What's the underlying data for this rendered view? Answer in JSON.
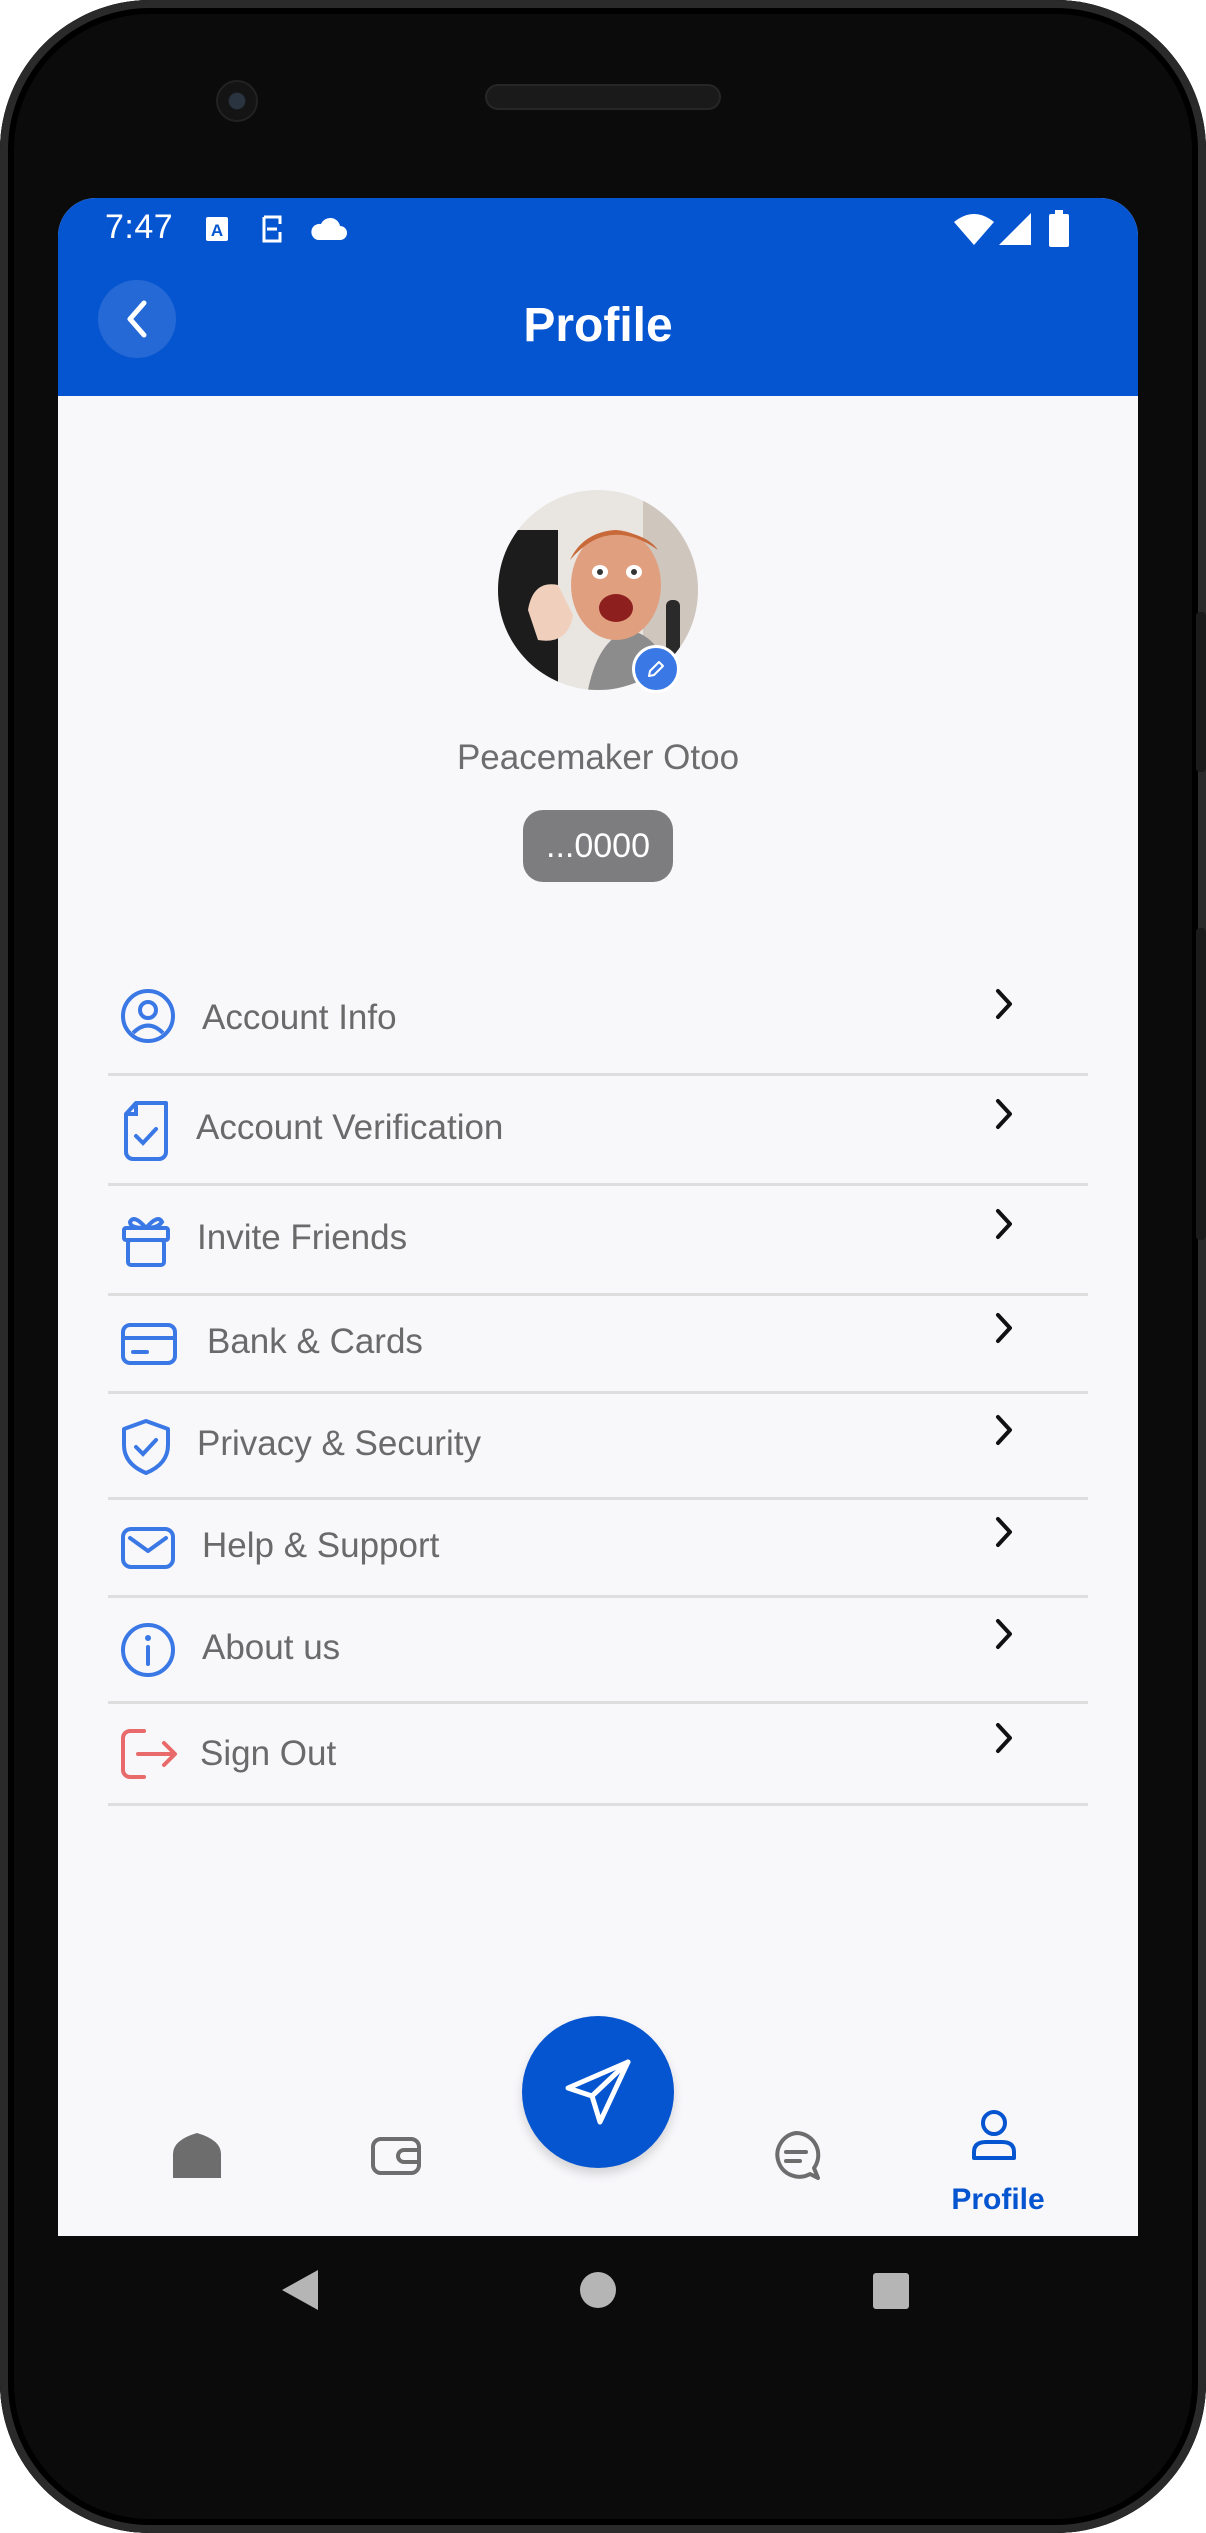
{
  "status_bar": {
    "time": "7:47"
  },
  "header": {
    "title": "Profile"
  },
  "profile": {
    "name": "Peacemaker Otoo",
    "account_suffix": "...0000"
  },
  "menu": {
    "items": [
      {
        "label": "Account Info",
        "icon": "user-circle-icon"
      },
      {
        "label": "Account Verification",
        "icon": "document-check-icon"
      },
      {
        "label": "Invite Friends",
        "icon": "gift-icon"
      },
      {
        "label": "Bank & Cards",
        "icon": "credit-card-icon"
      },
      {
        "label": "Privacy & Security",
        "icon": "shield-check-icon"
      },
      {
        "label": "Help & Support",
        "icon": "mail-icon"
      },
      {
        "label": "About us",
        "icon": "info-icon"
      },
      {
        "label": "Sign Out",
        "icon": "sign-out-icon"
      }
    ]
  },
  "bottom_nav": {
    "active_label": "Profile",
    "items": [
      "home-icon",
      "wallet-icon",
      "send-icon",
      "chat-icon",
      "profile-icon"
    ]
  },
  "colors": {
    "primary": "#0655d0",
    "icon_blue": "#3a78e6",
    "sign_out_red": "#e86a6a",
    "text_gray": "#6a6a6a",
    "background": "#f8f7fa"
  }
}
